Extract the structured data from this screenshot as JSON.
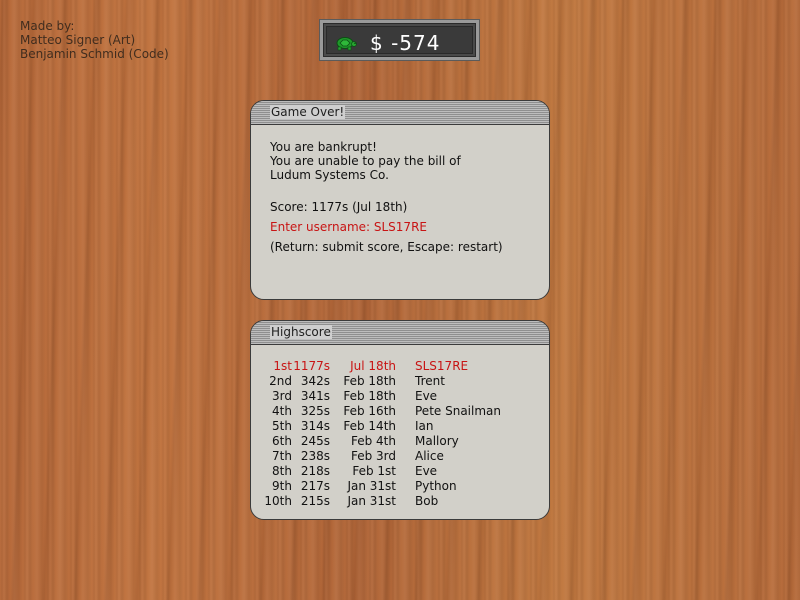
{
  "credits": {
    "lines": [
      "Made by:",
      "Matteo Signer (Art)",
      "Benjamin Schmid (Code)"
    ]
  },
  "money": {
    "icon": "turtle-icon",
    "value": "$ -574"
  },
  "gameover": {
    "title": "Game Over!",
    "lines": [
      "You are bankrupt!",
      "You are unable to pay the bill of",
      "Ludum Systems Co."
    ],
    "score": "Score: 1177s (Jul 18th)",
    "username_prompt": "Enter username: SLS17RE",
    "instructions": "(Return: submit score, Escape: restart)"
  },
  "highscore": {
    "title": "Highscore",
    "rows": [
      {
        "rank": "1st",
        "score": "1177s",
        "date": "Jul 18th",
        "name": "SLS17RE"
      },
      {
        "rank": "2nd",
        "score": "342s",
        "date": "Feb 18th",
        "name": "Trent"
      },
      {
        "rank": "3rd",
        "score": "341s",
        "date": "Feb 18th",
        "name": "Eve"
      },
      {
        "rank": "4th",
        "score": "325s",
        "date": "Feb 16th",
        "name": "Pete Snailman"
      },
      {
        "rank": "5th",
        "score": "314s",
        "date": "Feb 14th",
        "name": "Ian"
      },
      {
        "rank": "6th",
        "score": "245s",
        "date": "Feb 4th",
        "name": "Mallory"
      },
      {
        "rank": "7th",
        "score": "238s",
        "date": "Feb 3rd",
        "name": "Alice"
      },
      {
        "rank": "8th",
        "score": "218s",
        "date": "Feb 1st",
        "name": "Eve"
      },
      {
        "rank": "9th",
        "score": "217s",
        "date": "Jan 31st",
        "name": "Python"
      },
      {
        "rank": "10th",
        "score": "215s",
        "date": "Jan 31st",
        "name": "Bob"
      }
    ]
  },
  "colors": {
    "highlight": "#c81414",
    "wood": "#b86c3b",
    "panel": "#d2d0c9"
  }
}
